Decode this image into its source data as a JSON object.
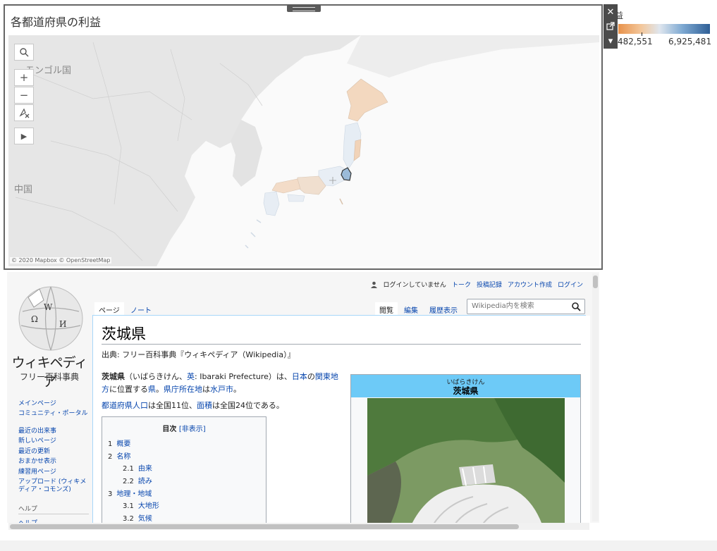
{
  "legend": {
    "title": "益",
    "min_label": "482,551",
    "max_label": "6,925,481"
  },
  "floating_buttons": {
    "close": "✕",
    "popout": "↗",
    "menu": "▾"
  },
  "map": {
    "title": "各都道府県の利益",
    "labels": {
      "mongolia": "モンゴル国",
      "china": "中国"
    },
    "attribution": "© 2020 Mapbox © OpenStreetMap",
    "tools": [
      "search",
      "zoom-in",
      "zoom-out",
      "pin-clear",
      "expand"
    ]
  },
  "wiki": {
    "wordmark": "ウィキペディア",
    "tagline": "フリー百科事典",
    "personal": {
      "status": "ログインしていません",
      "links": [
        "トーク",
        "投稿記録",
        "アカウント作成",
        "ログイン"
      ]
    },
    "tabs_left": [
      "ページ",
      "ノート"
    ],
    "tabs_right": [
      "閲覧",
      "編集",
      "履歴表示"
    ],
    "search_placeholder": "Wikipedia内を検索",
    "sidebar": [
      "メインページ",
      "コミュニティ・ポータル",
      "最近の出来事",
      "新しいページ",
      "最近の更新",
      "おまかせ表示",
      "練習用ページ",
      "アップロード (ウィキメディア・コモンズ)"
    ],
    "sidebar_help": "ヘルプ",
    "sidebar_cut": "ヘルプ",
    "article": {
      "title": "茨城県",
      "from": "出典: フリー百科事典『ウィキペディア（Wikipedia）』",
      "lead1_bold": "茨城県",
      "lead1_a": "（いばらきけん、",
      "lead1_link_en": "英",
      "lead1_b": ": Ibaraki Prefecture）は、",
      "lead1_link_japan": "日本",
      "lead1_c": "の",
      "lead1_link_kanto": "関東地方",
      "lead1_d": "に位置する",
      "lead1_link_ken": "県",
      "lead1_e": "。",
      "lead1_link_capital": "県庁所在地",
      "lead1_f": "は",
      "lead1_link_mito": "水戸市",
      "lead1_g": "。",
      "lead2_link_pop": "都道府県人口",
      "lead2_a": "は全国11位、",
      "lead2_link_area": "面積",
      "lead2_b": "は全国24位である。"
    },
    "toc": {
      "title": "目次",
      "toggle": "[非表示]",
      "items": [
        {
          "num": "1",
          "label": "概要",
          "level": 1
        },
        {
          "num": "2",
          "label": "名称",
          "level": 1
        },
        {
          "num": "2.1",
          "label": "由来",
          "level": 2
        },
        {
          "num": "2.2",
          "label": "読み",
          "level": 2
        },
        {
          "num": "3",
          "label": "地理・地域",
          "level": 1
        },
        {
          "num": "3.1",
          "label": "大地形",
          "level": 2
        },
        {
          "num": "3.2",
          "label": "気候",
          "level": 2
        }
      ]
    },
    "infobox": {
      "kana": "いばらきけん",
      "name": "茨城県"
    }
  }
}
